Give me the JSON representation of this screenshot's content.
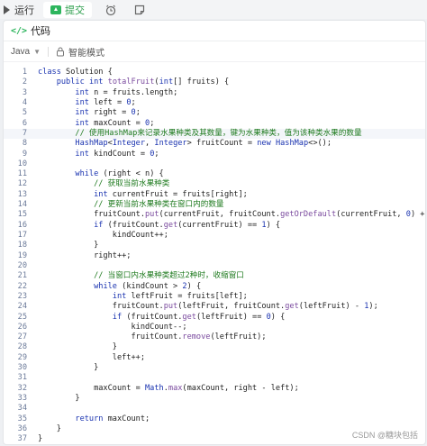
{
  "toolbar": {
    "run_label": "运行",
    "submit_label": "提交",
    "timer_icon": "alarm-clock-icon",
    "note_icon": "note-icon"
  },
  "panel": {
    "title": "代码",
    "language": "Java",
    "mode_label": "智能模式"
  },
  "code_lines": [
    "class Solution {",
    "    public int totalFruit(int[] fruits) {",
    "        int n = fruits.length;",
    "        int left = 0;",
    "        int right = 0;",
    "        int maxCount = 0;",
    "        // 使用HashMap来记录水果种类及其数量，键为水果种类，值为该种类水果的数量",
    "        HashMap<Integer, Integer> fruitCount = new HashMap<>();",
    "        int kindCount = 0;",
    "",
    "        while (right < n) {",
    "            // 获取当前水果种类",
    "            int currentFruit = fruits[right];",
    "            // 更新当前水果种类在窗口内的数量",
    "            fruitCount.put(currentFruit, fruitCount.getOrDefault(currentFruit, 0) + 1);",
    "            if (fruitCount.get(currentFruit) == 1) {",
    "                kindCount++;",
    "            }",
    "            right++;",
    "",
    "            // 当窗口内水果种类超过2种时，收缩窗口",
    "            while (kindCount > 2) {",
    "                int leftFruit = fruits[left];",
    "                fruitCount.put(leftFruit, fruitCount.get(leftFruit) - 1);",
    "                if (fruitCount.get(leftFruit) == 0) {",
    "                    kindCount--;",
    "                    fruitCount.remove(leftFruit);",
    "                }",
    "                left++;",
    "            }",
    "",
    "            maxCount = Math.max(maxCount, right - left);",
    "        }",
    "",
    "        return maxCount;",
    "    }",
    "}"
  ],
  "highlighted_line": 7,
  "watermark": "CSDN @糖块包括"
}
